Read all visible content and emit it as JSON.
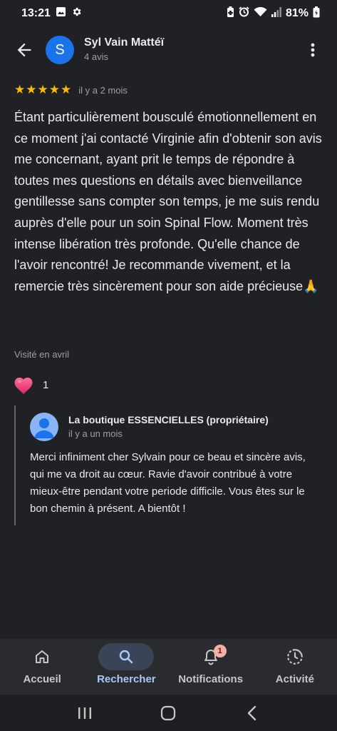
{
  "status_bar": {
    "time": "13:21",
    "battery": "81%"
  },
  "header": {
    "avatar_letter": "S",
    "name": "Syl Vain Mattéï",
    "review_count": "4 avis"
  },
  "review": {
    "rating": 5,
    "date": "il y a 2 mois",
    "text": "Étant particulièrement bousculé émotionnellement en ce moment j'ai contacté Virginie afin d'obtenir son avis me concernant, ayant prit le temps de répondre à toutes mes questions en détails avec bienveillance gentillesse sans compter son temps, je me suis rendu auprès d'elle pour un soin Spinal Flow. Moment très intense libération très profonde. Qu'elle chance de l'avoir rencontré! Je recommande vivement, et la remercie très sincèrement pour son aide précieuse🙏",
    "visited": "Visité en avril",
    "like_count": "1"
  },
  "owner_reply": {
    "name": "La boutique ESSENCIELLES (propriétaire)",
    "date": "il y a un mois",
    "text": "Merci infiniment cher Sylvain pour ce beau et sincère avis, qui me va droit au cœur. Ravie d'avoir contribué à votre mieux-être pendant votre periode difficile. Vous êtes sur le bon chemin à présent. A bientôt !"
  },
  "bottom_nav": {
    "items": [
      {
        "label": "Accueil",
        "icon": "home-icon"
      },
      {
        "label": "Rechercher",
        "icon": "search-icon"
      },
      {
        "label": "Notifications",
        "icon": "bell-icon",
        "badge": "1"
      },
      {
        "label": "Activité",
        "icon": "activity-icon"
      }
    ],
    "active_index": 1
  },
  "colors": {
    "background": "#202124",
    "star": "#fbbc04",
    "avatar": "#1a73e8",
    "active_nav": "#a8c7fa",
    "heart": "#e8457a"
  }
}
